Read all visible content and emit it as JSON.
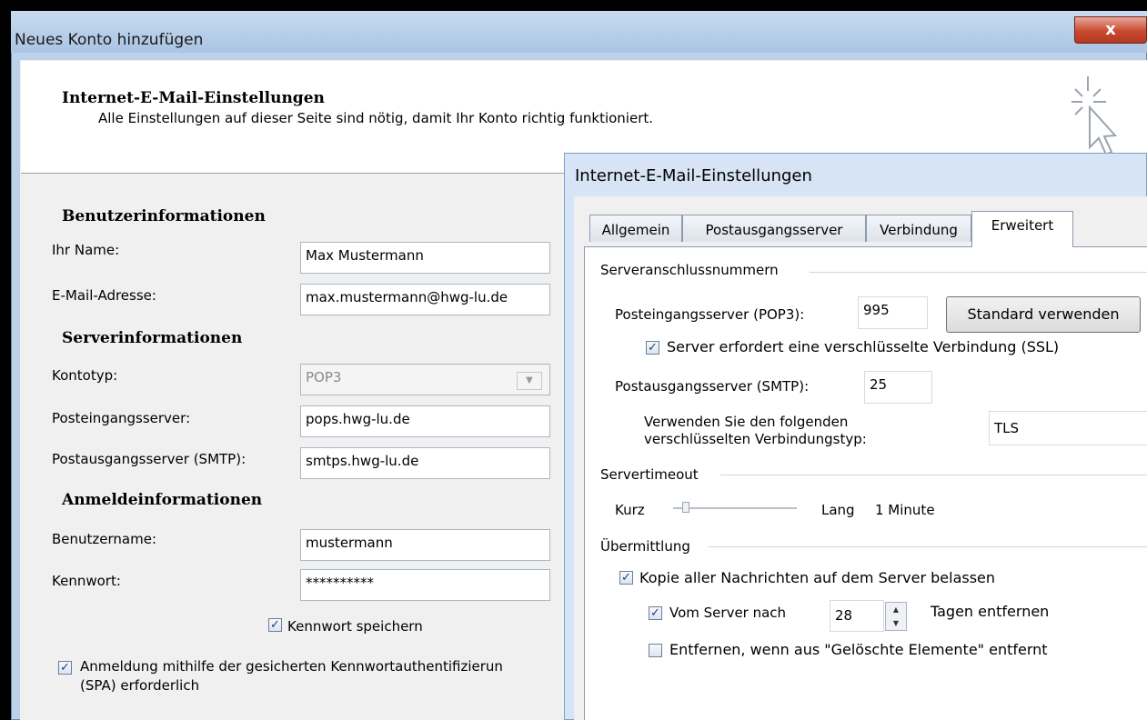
{
  "window": {
    "title": "Neues Konto hinzufügen",
    "close_label": "x",
    "header_title": "Internet-E-Mail-Einstellungen",
    "header_subtitle": "Alle Einstellungen auf dieser Seite sind nötig, damit Ihr Konto richtig funktioniert."
  },
  "user_info": {
    "heading": "Benutzerinformationen",
    "name_label": "Ihr Name:",
    "name_value": "Max Mustermann",
    "email_label": "E-Mail-Adresse:",
    "email_value": "max.mustermann@hwg-lu.de"
  },
  "server_info": {
    "heading": "Serverinformationen",
    "account_type_label": "Kontotyp:",
    "account_type_value": "POP3",
    "incoming_label": "Posteingangsserver:",
    "incoming_value": "pops.hwg-lu.de",
    "outgoing_label": "Postausgangsserver (SMTP):",
    "outgoing_value": "smtps.hwg-lu.de"
  },
  "login_info": {
    "heading": "Anmeldeinformationen",
    "username_label": "Benutzername:",
    "username_value": "mustermann",
    "password_label": "Kennwort:",
    "password_value": "**********",
    "save_password_label": "Kennwort speichern",
    "save_password_checked": true,
    "spa_label_line1": "Anmeldung mithilfe der gesicherten Kennwortauthentifizierun",
    "spa_label_line2": "(SPA) erforderlich",
    "spa_checked": true
  },
  "dialog": {
    "title": "Internet-E-Mail-Einstellungen",
    "tabs": [
      "Allgemein",
      "Postausgangsserver",
      "Verbindung",
      "Erweitert"
    ],
    "active_tab": "Erweitert",
    "ports_group": "Serveranschlussnummern",
    "pop3_label": "Posteingangsserver (POP3):",
    "pop3_value": "995",
    "default_button": "Standard verwenden",
    "ssl_label": "Server erfordert eine verschlüsselte Verbindung (SSL)",
    "ssl_checked": true,
    "smtp_label": "Postausgangsserver (SMTP):",
    "smtp_value": "25",
    "enc_label_line1": "Verwenden Sie den folgenden",
    "enc_label_line2": "verschlüsselten Verbindungstyp:",
    "enc_value": "TLS",
    "timeout_group": "Servertimeout",
    "timeout_short": "Kurz",
    "timeout_long": "Lang",
    "timeout_value": "1 Minute",
    "delivery_group": "Übermittlung",
    "keep_copy_label": "Kopie aller Nachrichten auf dem Server belassen",
    "keep_copy_checked": true,
    "remove_after_label": "Vom Server nach",
    "remove_after_days": "28",
    "remove_after_suffix": "Tagen entfernen",
    "remove_after_checked": true,
    "remove_deleted_label": "Entfernen, wenn aus \"Gelöschte Elemente\" entfernt",
    "remove_deleted_checked": false
  }
}
